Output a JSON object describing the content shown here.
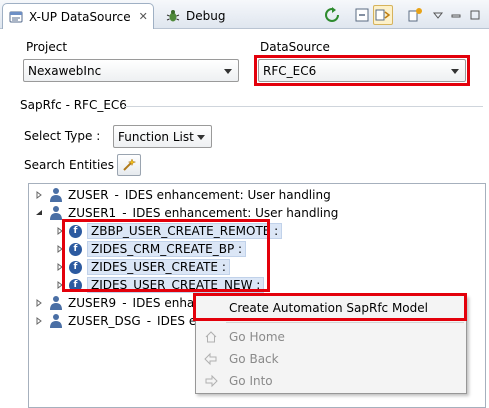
{
  "tabs": {
    "datasource_title": "X-UP DataSource",
    "close_glyph": "✕",
    "debug_title": "Debug"
  },
  "project": {
    "label": "Project",
    "value": "NexawebInc"
  },
  "datasource": {
    "label": "DataSource",
    "value": "RFC_EC6"
  },
  "section": {
    "title": "SapRfc - RFC_EC6"
  },
  "select_type": {
    "label": "Select Type :",
    "value": "Function List"
  },
  "search": {
    "label": "Search Entities :"
  },
  "tree": {
    "nodes": [
      {
        "name": "ZUSER",
        "desc": "IDES enhancement: User handling",
        "expanded": false
      },
      {
        "name": "ZUSER1",
        "desc": "IDES enhancement: User handling",
        "expanded": true
      },
      {
        "name": "ZUSER9",
        "desc": "IDES enhan",
        "expanded": false
      },
      {
        "name": "ZUSER_DSG",
        "desc": "IDES en",
        "expanded": false
      }
    ],
    "separator": "-",
    "functions": [
      "ZBBP_USER_CREATE_REMOTE :",
      "ZIDES_CRM_CREATE_BP :",
      "ZIDES_USER_CREATE :",
      "ZIDES_USER_CREATE_NEW :"
    ]
  },
  "context_menu": {
    "items": [
      {
        "label": "Create Automation SapRfc Model",
        "icon": "",
        "enabled": true
      },
      {
        "label": "Go Home",
        "icon": "home-icon",
        "enabled": false
      },
      {
        "label": "Go Back",
        "icon": "back-arrow-icon",
        "enabled": false
      },
      {
        "label": "Go Into",
        "icon": "forward-arrow-icon",
        "enabled": false
      }
    ]
  },
  "colors": {
    "highlight_box": "#e3000b",
    "function_icon": "#2c5aa0",
    "selection_bg": "#dbe6f6"
  }
}
